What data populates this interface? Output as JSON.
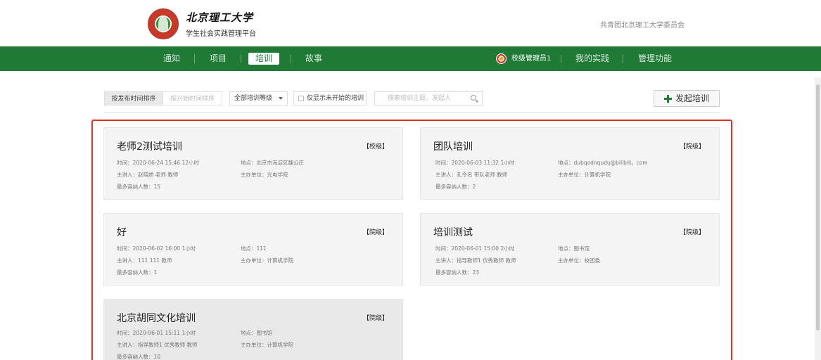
{
  "header": {
    "logo_name": "北京理工大学",
    "platform_name": "学生社会实践管理平台",
    "org_name": "共青团北京理工大学委员会"
  },
  "nav": {
    "items": [
      {
        "label": "通知"
      },
      {
        "label": "项目"
      },
      {
        "label": "培训"
      },
      {
        "label": "故事"
      }
    ],
    "active_item": "培训",
    "user_label": "校级管理员1",
    "right_items": [
      {
        "label": "我的实践"
      },
      {
        "label": "管理功能"
      }
    ]
  },
  "toolbar": {
    "sort_by_publish": "按发布时间排序",
    "sort_by_start": "按开始时间排序",
    "level_select": "全部培训等级",
    "only_not_started": "仅显示未开始的培训",
    "search_placeholder": "搜索培训主题、发起人",
    "add_button": "发起培训"
  },
  "trainings": [
    {
      "title": "老师2测试培训",
      "level": "【校级】",
      "time": "时间：2020-06-24 15:46 12小时",
      "location": "地点：北京市海淀区魏公庄",
      "speaker": "主讲人：赵晓娇 老师 教师",
      "organizer": "主办单位：光电学院",
      "capacity": "最多容纳人数：15"
    },
    {
      "title": "团队培训",
      "level": "【院级】",
      "time": "时间：2020-06-03 11:32 1小时",
      "location": "地点：dubqodnqudu@bilibili。com",
      "speaker": "主讲人：孔令名 带队老师 教师",
      "organizer": "主办单位：计算机学院",
      "capacity": "最多容纳人数：2"
    },
    {
      "title": "好",
      "level": "【院级】",
      "time": "时间：2020-06-02 16:00 1小时",
      "location": "地点：111",
      "speaker": "主讲人：111 111 教师",
      "organizer": "主办单位：计算机学院",
      "capacity": "最多容纳人数：1"
    },
    {
      "title": "培训测试",
      "level": "【院级】",
      "time": "时间：2020-06-01 15:00 2小时",
      "location": "地点：图书馆",
      "speaker": "主讲人：指导教师1 优秀教师 教师",
      "organizer": "主办单位：校团委",
      "capacity": "最多容纳人数：23"
    },
    {
      "title": "北京胡同文化培训",
      "level": "【院级】",
      "time": "时间：2020-06-01 15:11 1小时",
      "location": "地点：图书馆",
      "speaker": "主讲人：指导教师1 优秀教师 教师",
      "organizer": "主办单位：计算机学院",
      "capacity": "最多容纳人数：10"
    }
  ],
  "colors": {
    "nav_green": "#1f7a36",
    "highlight_red": "#e0302a",
    "card_bg": "#f4f4f4"
  }
}
